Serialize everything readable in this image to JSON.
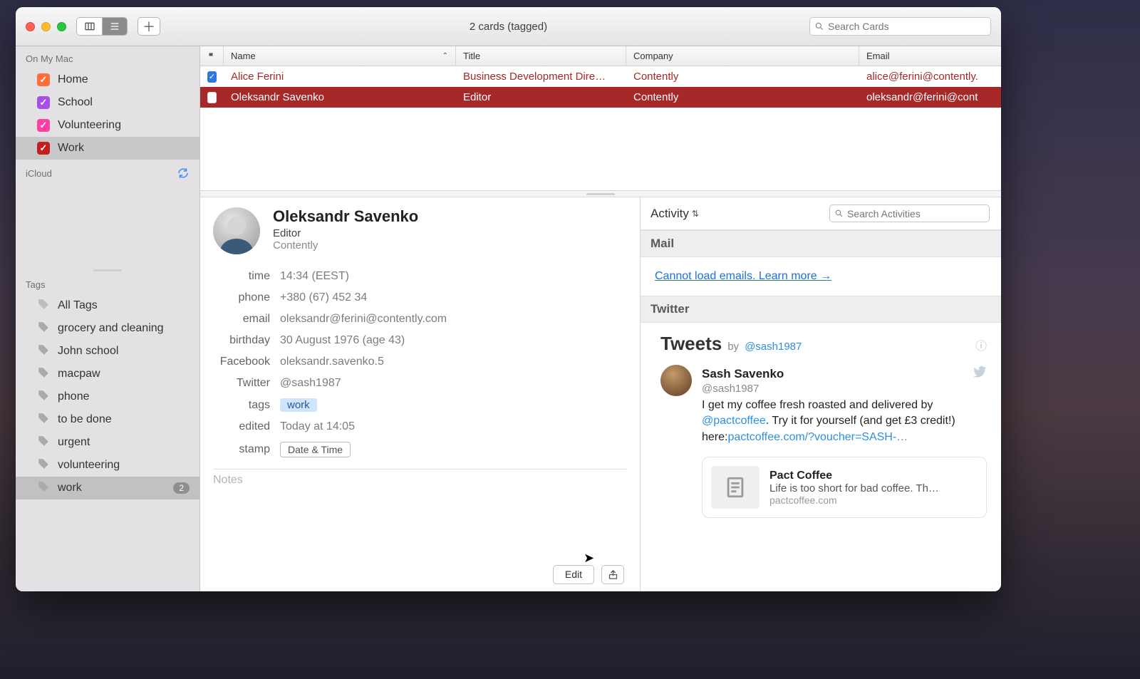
{
  "window": {
    "title": "2 cards (tagged)"
  },
  "search": {
    "placeholder": "Search Cards"
  },
  "sidebar": {
    "groups_head": "On My Mac",
    "groups": [
      {
        "label": "Home",
        "color": "#ff6d3b",
        "selected": false
      },
      {
        "label": "School",
        "color": "#a750e6",
        "selected": false
      },
      {
        "label": "Volunteering",
        "color": "#ff3ea5",
        "selected": false
      },
      {
        "label": "Work",
        "color": "#c22020",
        "selected": true
      }
    ],
    "cloud_head": "iCloud",
    "tags_head": "Tags",
    "tags": [
      {
        "label": "All Tags"
      },
      {
        "label": "grocery and cleaning"
      },
      {
        "label": "John school"
      },
      {
        "label": "macpaw"
      },
      {
        "label": "phone"
      },
      {
        "label": "to be done"
      },
      {
        "label": "urgent"
      },
      {
        "label": "volunteering"
      },
      {
        "label": "work",
        "count": "2",
        "selected": true
      }
    ]
  },
  "table": {
    "cols": {
      "name": "Name",
      "title": "Title",
      "company": "Company",
      "email": "Email"
    },
    "rows": [
      {
        "flagged": true,
        "name": "Alice Ferini",
        "title": "Business Development Dire…",
        "company": "Contently",
        "email": "alice@ferini@contently."
      },
      {
        "flagged": false,
        "name": "Oleksandr Savenko",
        "title": "Editor",
        "company": "Contently",
        "email": "oleksandr@ferini@cont"
      }
    ]
  },
  "card": {
    "name": "Oleksandr Savenko",
    "role": "Editor",
    "company": "Contently",
    "rows": {
      "time_l": "time",
      "time_v": "14:34 (EEST)",
      "phone_l": "phone",
      "phone_v": "+380 (67) 452 34",
      "email_l": "email",
      "email_v": "oleksandr@ferini@contently.com",
      "bday_l": "birthday",
      "bday_v": "30 August 1976 (age 43)",
      "fb_l": "Facebook",
      "fb_v": "oleksandr.savenko.5",
      "tw_l": "Twitter",
      "tw_v": "@sash1987",
      "tags_l": "tags",
      "tags_v": "work",
      "edited_l": "edited",
      "edited_v": "Today at 14:05",
      "stamp_l": "stamp",
      "stamp_btn": "Date & Time"
    },
    "notes_ph": "Notes",
    "edit_btn": "Edit"
  },
  "activity": {
    "title": "Activity",
    "search_ph": "Search Activities",
    "mail_head": "Mail",
    "mail_err": "Cannot load emails. Learn more →",
    "tw_head": "Twitter",
    "tweets_title": "Tweets",
    "tweets_by": "by",
    "tweets_handle": "@sash1987",
    "tweet": {
      "name": "Sash Savenko",
      "handle": "@sash1987",
      "t1": "I get my coffee fresh roasted and delivered by ",
      "m1": "@pactcoffee",
      "t2": ". Try it for yourself (and get £3 credit!) here:",
      "l1": "pactcoffee.com/?voucher=SASH-…"
    },
    "card": {
      "title": "Pact Coffee",
      "sub": "Life is too short for bad coffee. Th…",
      "domain": "pactcoffee.com"
    }
  }
}
